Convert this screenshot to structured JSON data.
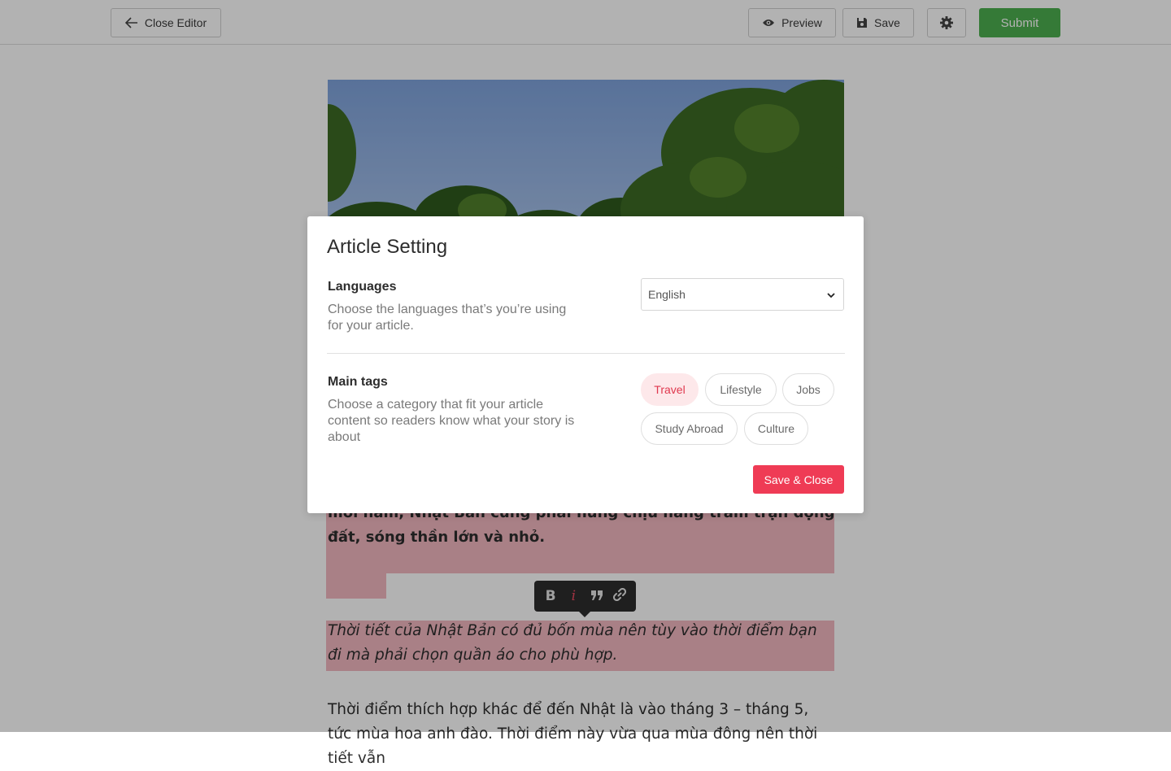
{
  "topbar": {
    "close_editor": "Close Editor",
    "preview": "Preview",
    "save": "Save",
    "submit": "Submit",
    "submit_color": "#4caf50"
  },
  "article": {
    "bold_paragraph": "Nhật Bản là đất nước có khí hậu ôn hòa, nằm trong vùng ôn đới, với 4 mùa rõ rệt và thiên nhiên tươi đẹp, thực vật phong phú, đa dạng và xanh tốt. Tuy nhiên, cũng vì địa thế này mà mỗi năm, Nhật Bản cũng phải hứng chịu hàng trăm trận động đất, sóng thần lớn và nhỏ.",
    "italic_paragraph": "Thời tiết của Nhật Bản có đủ bốn mùa nên tùy vào thời điểm bạn đi mà phải chọn quần áo cho phù hợp.",
    "normal_paragraph": "Thời điểm thích hợp khác để đến Nhật là vào tháng 3 – tháng 5, tức mùa hoa anh đào. Thời điểm này vừa qua mùa đông nên thời tiết vẫn",
    "highlight_color": "#f3b8c1"
  },
  "format_toolbar": {
    "bold_icon": "B",
    "italic_icon": "i"
  },
  "modal": {
    "title": "Article Setting",
    "languages": {
      "label": "Languages",
      "description": "Choose the languages that’s you’re using for your article.",
      "selected": "English"
    },
    "tags": {
      "label": "Main tags",
      "description": "Choose a category that fit your article content so readers know what your story is about",
      "items": [
        "Travel",
        "Lifestyle",
        "Jobs",
        "Study Abroad",
        "Culture"
      ],
      "active": "Travel"
    },
    "save_close": "Save & Close",
    "accent_color": "#ef3b55"
  }
}
